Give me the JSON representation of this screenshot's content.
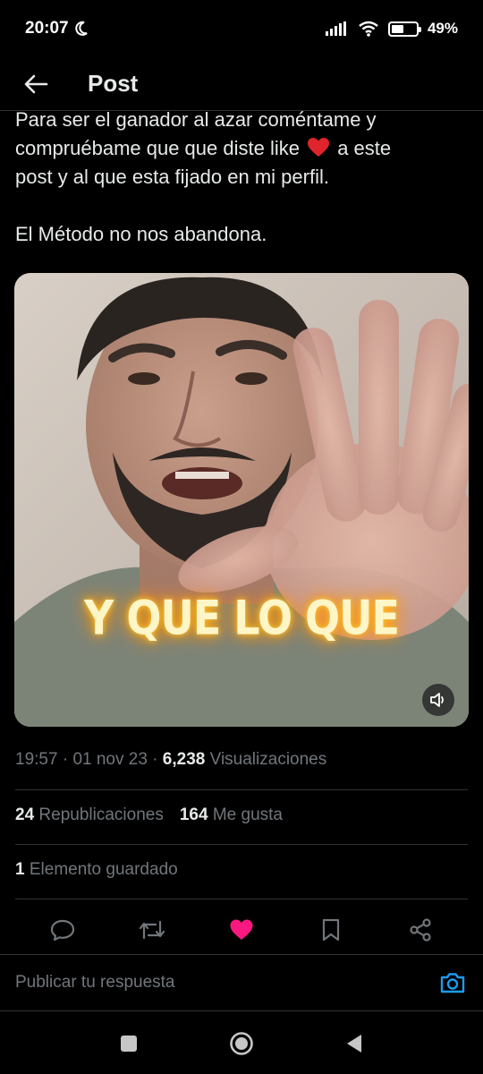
{
  "status_bar": {
    "time": "20:07",
    "battery": "49%",
    "battery_level": 0.49
  },
  "header": {
    "title": "Post"
  },
  "post": {
    "line1": "Para ser el ganador al azar coméntame y",
    "line2_pre": "compruébame que que diste like ",
    "line2_post": " a este",
    "line3": "post y al que esta fijado en mi perfil.",
    "line5": "El Método no nos abandona."
  },
  "video": {
    "caption": "Y QUE LO QUE"
  },
  "meta": {
    "time": "19:57",
    "sep1": " · ",
    "date": "01 nov 23",
    "sep2": " · ",
    "views": "6,238",
    "views_label": " Visualizaciones"
  },
  "stats": {
    "reposts": "24",
    "reposts_label": " Republicaciones",
    "likes": "164",
    "likes_label": " Me gusta",
    "bookmarks": "1",
    "bookmarks_label": " Elemento guardado"
  },
  "reply": {
    "placeholder": "Publicar tu respuesta"
  },
  "colors": {
    "accent_blue": "#1d9bf0",
    "like_pink": "#f91880",
    "muted": "#71767b",
    "text": "#e7e9ea",
    "border": "#2f3336"
  },
  "icons": {
    "back": "arrow-left-icon",
    "reply": "speech-bubble-icon",
    "repost": "repost-icon",
    "like": "heart-filled-icon",
    "bookmark": "bookmark-icon",
    "share": "share-icon",
    "camera": "camera-icon",
    "mute": "speaker-icon"
  }
}
